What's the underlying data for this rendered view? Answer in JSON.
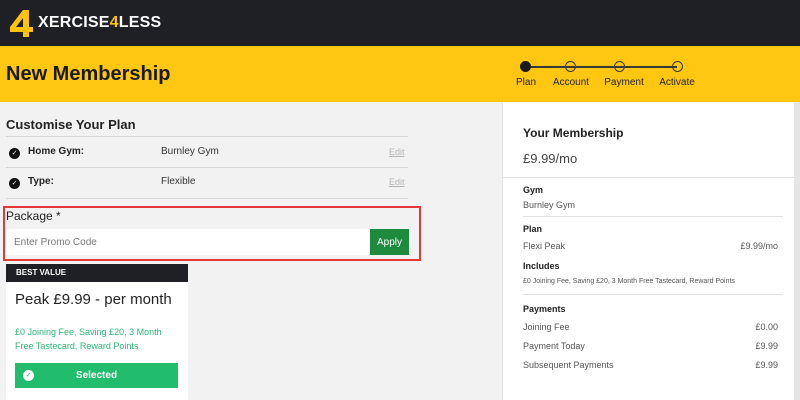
{
  "brand": {
    "logo_text_pre": "XERCISE",
    "logo_text_num": "4",
    "logo_text_post": "LESS",
    "accent": "#ffc612",
    "dark": "#1f2026"
  },
  "header": {
    "title": "New Membership"
  },
  "steps": [
    {
      "label": "Plan",
      "active": true
    },
    {
      "label": "Account",
      "active": false
    },
    {
      "label": "Payment",
      "active": false
    },
    {
      "label": "Activate",
      "active": false
    }
  ],
  "customise": {
    "title": "Customise Your Plan",
    "rows": [
      {
        "label": "Home Gym:",
        "value": "Burnley Gym",
        "edit": "Edit"
      },
      {
        "label": "Type:",
        "value": "Flexible",
        "edit": "Edit"
      }
    ]
  },
  "package": {
    "label": "Package *",
    "promo_placeholder": "Enter Promo Code",
    "apply_label": "Apply"
  },
  "card": {
    "badge": "BEST VALUE",
    "title": "Peak £9.99 - per month",
    "description": "£0 Joining Fee, Saving £20, 3 Month Free Tastecard, Reward Points",
    "selected_label": "Selected"
  },
  "summary": {
    "title": "Your Membership",
    "price": "£9.99/mo",
    "gym_heading": "Gym",
    "gym_value": "Burnley Gym",
    "plan_heading": "Plan",
    "plan_name": "Flexi Peak",
    "plan_price": "£9.99/mo",
    "includes_heading": "Includes",
    "includes_text": "£0 Joining Fee, Saving £20, 3 Month Free Tastecard, Reward Points",
    "payments_heading": "Payments",
    "payments": [
      {
        "label": "Joining Fee",
        "amount": "£0.00"
      },
      {
        "label": "Payment Today",
        "amount": "£9.99"
      },
      {
        "label": "Subsequent Payments",
        "amount": "£9.99"
      }
    ]
  }
}
